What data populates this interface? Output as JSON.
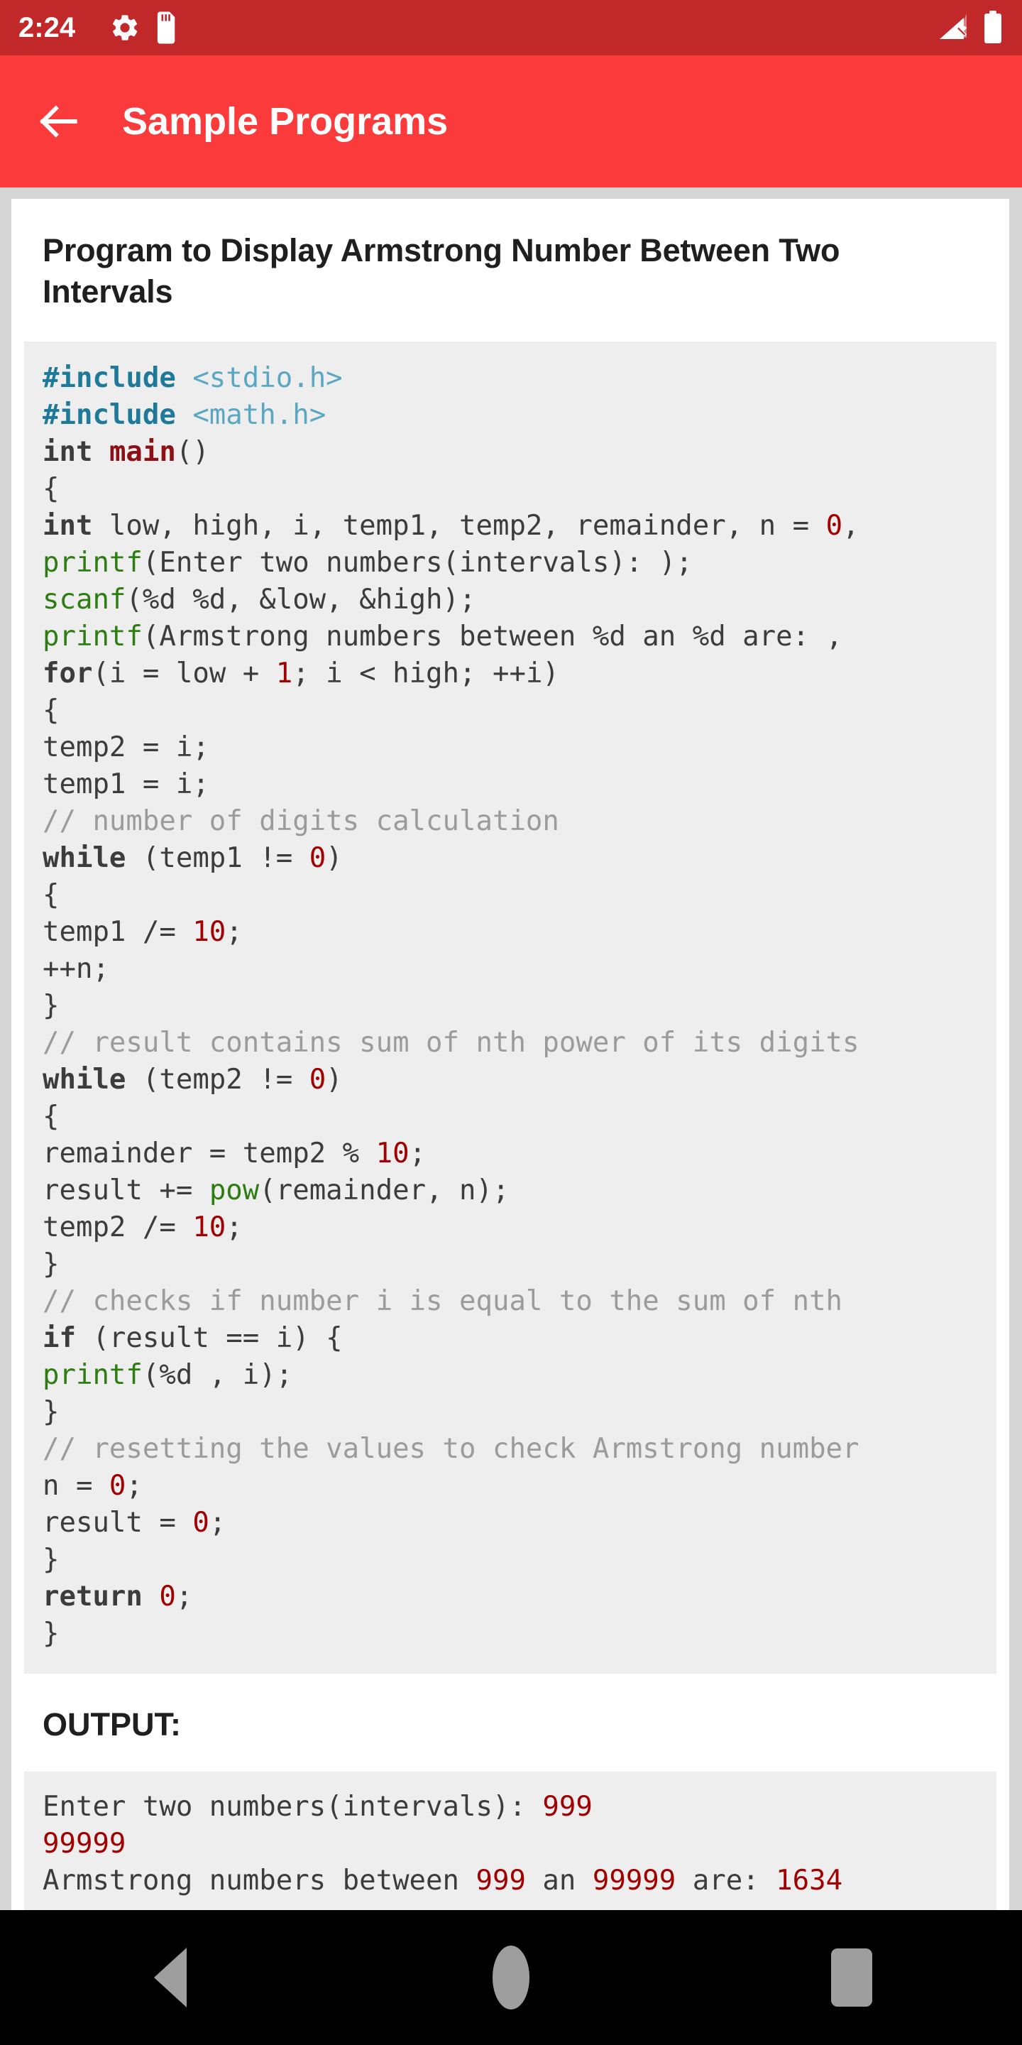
{
  "status_bar": {
    "time": "2:24",
    "icons": [
      "gear-icon",
      "sd-card-icon"
    ],
    "right_icons": [
      "signal-no-sim-icon",
      "battery-full-icon"
    ],
    "background_color": "#c0282a"
  },
  "app_bar": {
    "back_icon": "arrow-left-icon",
    "title": "Sample Programs",
    "background_color": "#fb3b3b",
    "text_color": "#ffffff"
  },
  "program": {
    "title": "Program to Display Armstrong Number Between Two Intervals",
    "code_lines": [
      [
        {
          "t": "#include",
          "c": "pp"
        },
        {
          "t": " ",
          "c": ""
        },
        {
          "t": "<stdio.h>",
          "c": "hdr"
        }
      ],
      [
        {
          "t": "#include",
          "c": "pp"
        },
        {
          "t": " ",
          "c": ""
        },
        {
          "t": "<math.h>",
          "c": "hdr"
        }
      ],
      [
        {
          "t": "int",
          "c": "k"
        },
        {
          "t": " ",
          "c": ""
        },
        {
          "t": "main",
          "c": "fnm"
        },
        {
          "t": "()",
          "c": ""
        }
      ],
      [
        {
          "t": "{",
          "c": ""
        }
      ],
      [
        {
          "t": "int",
          "c": "k"
        },
        {
          "t": " low, high, i, temp1, temp2, remainder, n = ",
          "c": ""
        },
        {
          "t": "0",
          "c": "num"
        },
        {
          "t": ",",
          "c": ""
        }
      ],
      [
        {
          "t": "printf",
          "c": "fn"
        },
        {
          "t": "(Enter two numbers(intervals): );",
          "c": ""
        }
      ],
      [
        {
          "t": "scanf",
          "c": "fn"
        },
        {
          "t": "(%d %d, &low, &high);",
          "c": ""
        }
      ],
      [
        {
          "t": "printf",
          "c": "fn"
        },
        {
          "t": "(Armstrong numbers between %d an %d are: ,",
          "c": ""
        }
      ],
      [
        {
          "t": "for",
          "c": "k"
        },
        {
          "t": "(i = low + ",
          "c": ""
        },
        {
          "t": "1",
          "c": "num"
        },
        {
          "t": "; i < high; ++i)",
          "c": ""
        }
      ],
      [
        {
          "t": "{",
          "c": ""
        }
      ],
      [
        {
          "t": "temp2 = i;",
          "c": ""
        }
      ],
      [
        {
          "t": "temp1 = i;",
          "c": ""
        }
      ],
      [
        {
          "t": "// number of digits calculation",
          "c": "cm"
        }
      ],
      [
        {
          "t": "while",
          "c": "k"
        },
        {
          "t": " (temp1 != ",
          "c": ""
        },
        {
          "t": "0",
          "c": "num"
        },
        {
          "t": ")",
          "c": ""
        }
      ],
      [
        {
          "t": "{",
          "c": ""
        }
      ],
      [
        {
          "t": "temp1 /= ",
          "c": ""
        },
        {
          "t": "10",
          "c": "num"
        },
        {
          "t": ";",
          "c": ""
        }
      ],
      [
        {
          "t": "++n;",
          "c": ""
        }
      ],
      [
        {
          "t": "}",
          "c": ""
        }
      ],
      [
        {
          "t": "// result contains sum of nth power of its digits",
          "c": "cm"
        }
      ],
      [
        {
          "t": "while",
          "c": "k"
        },
        {
          "t": " (temp2 != ",
          "c": ""
        },
        {
          "t": "0",
          "c": "num"
        },
        {
          "t": ")",
          "c": ""
        }
      ],
      [
        {
          "t": "{",
          "c": ""
        }
      ],
      [
        {
          "t": "remainder = temp2 % ",
          "c": ""
        },
        {
          "t": "10",
          "c": "num"
        },
        {
          "t": ";",
          "c": ""
        }
      ],
      [
        {
          "t": "result += ",
          "c": ""
        },
        {
          "t": "pow",
          "c": "fn"
        },
        {
          "t": "(remainder, n);",
          "c": ""
        }
      ],
      [
        {
          "t": "temp2 /= ",
          "c": ""
        },
        {
          "t": "10",
          "c": "num"
        },
        {
          "t": ";",
          "c": ""
        }
      ],
      [
        {
          "t": "}",
          "c": ""
        }
      ],
      [
        {
          "t": "// checks if number i is equal to the sum of nth",
          "c": "cm"
        }
      ],
      [
        {
          "t": "if",
          "c": "k"
        },
        {
          "t": " (result == i) {",
          "c": ""
        }
      ],
      [
        {
          "t": "printf",
          "c": "fn"
        },
        {
          "t": "(%d , i);",
          "c": ""
        }
      ],
      [
        {
          "t": "}",
          "c": ""
        }
      ],
      [
        {
          "t": "// resetting the values to check Armstrong number",
          "c": "cm"
        }
      ],
      [
        {
          "t": "n = ",
          "c": ""
        },
        {
          "t": "0",
          "c": "num"
        },
        {
          "t": ";",
          "c": ""
        }
      ],
      [
        {
          "t": "result = ",
          "c": ""
        },
        {
          "t": "0",
          "c": "num"
        },
        {
          "t": ";",
          "c": ""
        }
      ],
      [
        {
          "t": "}",
          "c": ""
        }
      ],
      [
        {
          "t": "return",
          "c": "k"
        },
        {
          "t": " ",
          "c": ""
        },
        {
          "t": "0",
          "c": "num"
        },
        {
          "t": ";",
          "c": ""
        }
      ],
      [
        {
          "t": "}",
          "c": ""
        }
      ]
    ],
    "output_label": "OUTPUT:",
    "output_lines": [
      [
        {
          "t": "Enter two numbers(intervals): ",
          "c": ""
        },
        {
          "t": "999",
          "c": "num"
        }
      ],
      [
        {
          "t": "99999",
          "c": "num"
        }
      ],
      [
        {
          "t": "Armstrong numbers between ",
          "c": ""
        },
        {
          "t": "999",
          "c": "num"
        },
        {
          "t": " an ",
          "c": ""
        },
        {
          "t": "99999",
          "c": "num"
        },
        {
          "t": " are: ",
          "c": ""
        },
        {
          "t": "1634",
          "c": "num"
        }
      ]
    ]
  },
  "nav_bar": {
    "back_label": "back-triangle",
    "home_label": "home-circle",
    "recents_label": "recents-square",
    "background_color": "#000000"
  },
  "colors": {
    "accent": "#fb3b3b",
    "status": "#c0282a",
    "page_bg": "#d6d6d6",
    "code_bg": "#eeeeee",
    "keyword": "#3c3c3c",
    "preproc": "#1f7a99",
    "header": "#5aa7c4",
    "function": "#2e7d12",
    "number": "#a00000",
    "comment": "#9b9b9b"
  }
}
